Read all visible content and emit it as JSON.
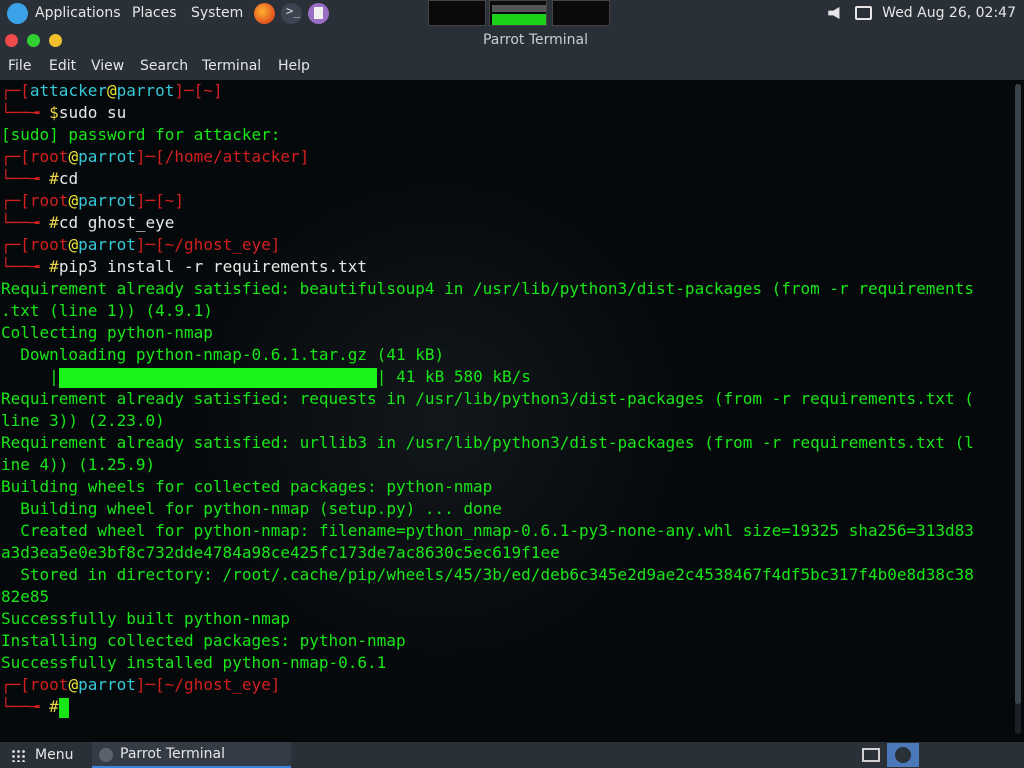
{
  "top_panel": {
    "applications": "Applications",
    "places": "Places",
    "system": "System",
    "datetime": "Wed Aug 26, 02:47"
  },
  "window": {
    "title": "Parrot Terminal"
  },
  "menubar": {
    "items": [
      "File",
      "Edit",
      "View",
      "Search",
      "Terminal",
      "Help"
    ]
  },
  "terminal": {
    "user1": "attacker",
    "host": "parrot",
    "at": "@",
    "dir_home": "~",
    "dir_home_attacker": "/home/attacker",
    "dir_ghost": "~/ghost_eye",
    "root": "root",
    "prompt_user": "$",
    "prompt_root": "#",
    "cmd_sudo": "sudo su",
    "sudo_pw": "[sudo] password for attacker:",
    "cmd_cd": "cd",
    "cmd_cd_ghost": "cd ghost_eye",
    "cmd_pip": "pip3 install -r requirements.txt",
    "out": [
      "Requirement already satisfied: beautifulsoup4 in /usr/lib/python3/dist-packages (from -r requirements",
      ".txt (line 1)) (4.9.1)",
      "Collecting python-nmap",
      "  Downloading python-nmap-0.6.1.tar.gz (41 kB)",
      "Requirement already satisfied: requests in /usr/lib/python3/dist-packages (from -r requirements.txt (",
      "line 3)) (2.23.0)",
      "Requirement already satisfied: urllib3 in /usr/lib/python3/dist-packages (from -r requirements.txt (l",
      "ine 4)) (1.25.9)",
      "Building wheels for collected packages: python-nmap",
      "  Building wheel for python-nmap (setup.py) ... done",
      "  Created wheel for python-nmap: filename=python_nmap-0.6.1-py3-none-any.whl size=19325 sha256=313d83",
      "a3d3ea5e0e3bf8c732dde4784a98ce425fc173de7ac8630c5ec619f1ee",
      "  Stored in directory: /root/.cache/pip/wheels/45/3b/ed/deb6c345e2d9ae2c4538467f4df5bc317f4b0e8d38c38",
      "82e85",
      "Successfully built python-nmap",
      "Installing collected packages: python-nmap",
      "Successfully installed python-nmap-0.6.1"
    ],
    "progress_prefix": "     |",
    "progress_suffix": "| 41 kB 580 kB/s",
    "progress_fraction": 1.0
  },
  "taskbar": {
    "menu": "Menu",
    "task": "Parrot Terminal"
  }
}
